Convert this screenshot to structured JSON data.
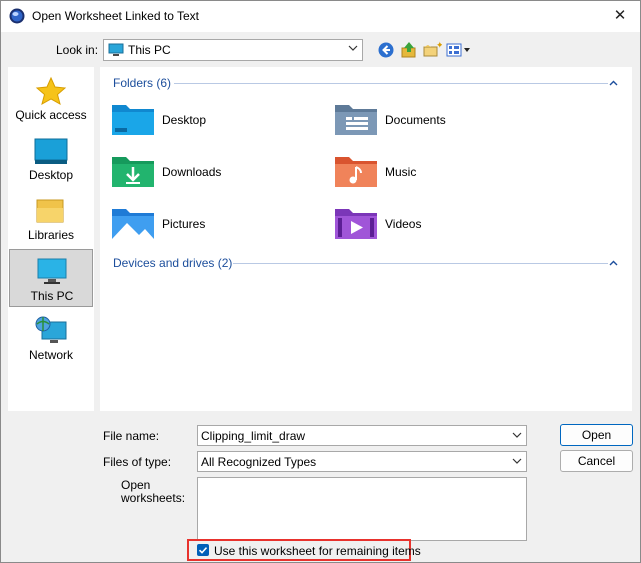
{
  "window": {
    "title": "Open Worksheet Linked to Text",
    "close_glyph": "✕"
  },
  "toolbar": {
    "lookin_label": "Look in:",
    "lookin_value": "This PC",
    "icons": [
      "back-icon",
      "up-folder-icon",
      "new-folder-icon",
      "view-menu-icon"
    ]
  },
  "places": [
    {
      "label": "Quick access",
      "icon": "star-icon",
      "selected": false
    },
    {
      "label": "Desktop",
      "icon": "desktop-icon",
      "selected": false
    },
    {
      "label": "Libraries",
      "icon": "libraries-icon",
      "selected": false
    },
    {
      "label": "This PC",
      "icon": "computer-icon",
      "selected": true
    },
    {
      "label": "Network",
      "icon": "network-icon",
      "selected": false
    }
  ],
  "filepane": {
    "folders_title": "Folders (6)",
    "drives_title": "Devices and drives (2)",
    "folders": [
      {
        "label": "Desktop",
        "icon": "desktop-folder-icon"
      },
      {
        "label": "Documents",
        "icon": "documents-folder-icon"
      },
      {
        "label": "Downloads",
        "icon": "downloads-folder-icon"
      },
      {
        "label": "Music",
        "icon": "music-folder-icon"
      },
      {
        "label": "Pictures",
        "icon": "pictures-folder-icon"
      },
      {
        "label": "Videos",
        "icon": "videos-folder-icon"
      }
    ]
  },
  "form": {
    "filename_label": "File name:",
    "filename_value": "Clipping_limit_draw",
    "filetype_label": "Files of type:",
    "filetype_value": "All Recognized Types",
    "open_ws_label_1": "Open",
    "open_ws_label_2": "worksheets:",
    "checkbox_label": "Use this worksheet for remaining items",
    "checkbox_checked": true
  },
  "buttons": {
    "open": "Open",
    "cancel": "Cancel"
  },
  "colors": {
    "accent": "#005fb8",
    "group_title": "#1c4e9c",
    "highlight": "#e8322d"
  }
}
